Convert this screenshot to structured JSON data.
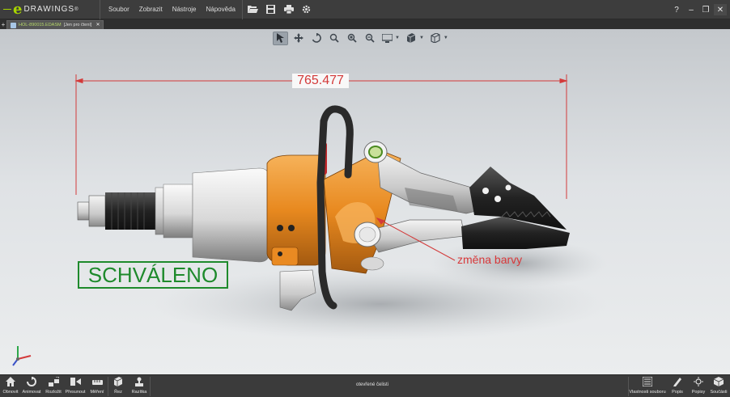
{
  "app": {
    "logo_letter": "e",
    "logo_word": "DRAWINGS",
    "logo_mark": "®"
  },
  "menu": {
    "items": [
      "Soubor",
      "Zobrazit",
      "Nástroje",
      "Nápověda"
    ]
  },
  "toolbar_icons": [
    "open-icon",
    "save-icon",
    "print-icon",
    "settings-icon"
  ],
  "window": {
    "help": "?",
    "minimize": "–",
    "restore": "❐",
    "close": "✕"
  },
  "tabs": {
    "add": "+",
    "document": {
      "name": "HOL-890015.EDASM",
      "suffix": " [Jen pro čtení]",
      "close": "✕"
    }
  },
  "heads_up_icons": [
    "select-icon",
    "pan-icon",
    "rotate-icon",
    "zoom-to-fit-icon",
    "zoom-area-icon",
    "zoom-icon",
    "display-style-icon",
    "view-orientation-icon",
    "section-view-icon"
  ],
  "markup": {
    "dimension": "765.477",
    "note": "změna barvy",
    "stamp": "SCHVÁLENO"
  },
  "colors": {
    "markup_red": "#d33a3a",
    "stamp_green": "#1e8a2c",
    "accent_orange": "#e8891f",
    "brand_green": "#a8d400"
  },
  "bottom_toolbar": {
    "left": [
      {
        "icon": "home-icon",
        "label": "Obnovit"
      },
      {
        "icon": "animate-icon",
        "label": "Animovat"
      },
      {
        "icon": "explode-icon",
        "label": "Rozložit"
      },
      {
        "icon": "move-icon",
        "label": "Přesunout"
      },
      {
        "icon": "measure-icon",
        "label": "Měření"
      },
      {
        "icon": "section-icon",
        "label": "Řez"
      },
      {
        "icon": "stamp-icon",
        "label": "Razítka"
      }
    ],
    "status": "otevřené čelisti",
    "right": [
      {
        "icon": "file-properties-icon",
        "label": "Vlastnosti souboru"
      },
      {
        "icon": "markup-icon",
        "label": "Popis"
      },
      {
        "icon": "annotations-icon",
        "label": "Popisy"
      },
      {
        "icon": "components-icon",
        "label": "Součásti"
      }
    ]
  }
}
